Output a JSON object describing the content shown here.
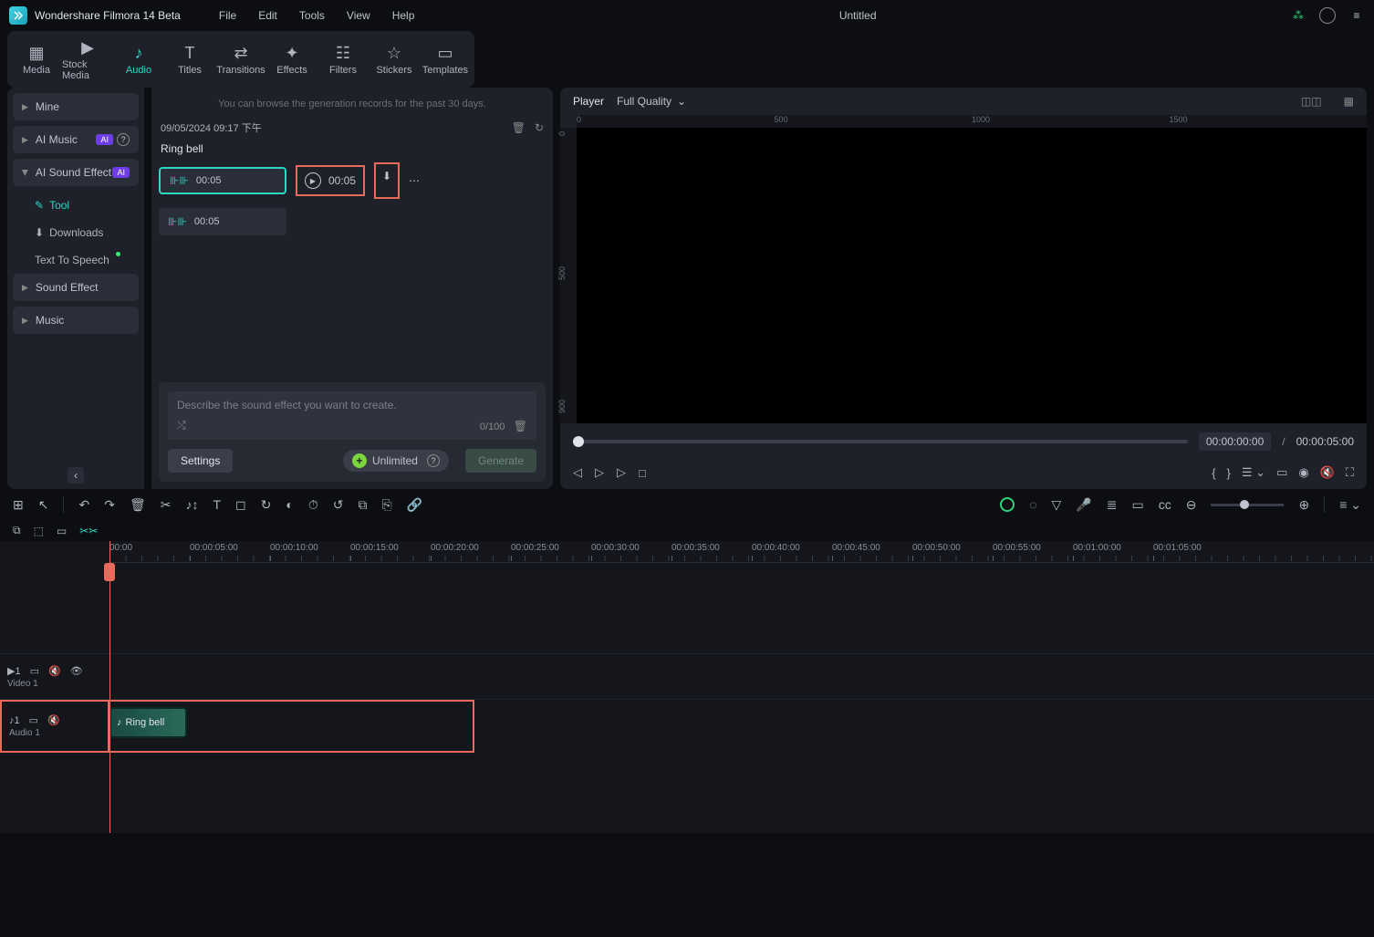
{
  "app": {
    "title": "Wondershare Filmora 14 Beta",
    "doc": "Untitled"
  },
  "menu": [
    "File",
    "Edit",
    "Tools",
    "View",
    "Help"
  ],
  "tabs": [
    {
      "label": "Media",
      "icon": "▦"
    },
    {
      "label": "Stock Media",
      "icon": "▶"
    },
    {
      "label": "Audio",
      "icon": "♪"
    },
    {
      "label": "Titles",
      "icon": "T"
    },
    {
      "label": "Transitions",
      "icon": "⇄"
    },
    {
      "label": "Effects",
      "icon": "✦"
    },
    {
      "label": "Filters",
      "icon": "⋮⋮"
    },
    {
      "label": "Stickers",
      "icon": "☆"
    },
    {
      "label": "Templates",
      "icon": "▭"
    }
  ],
  "sidebar": {
    "mine": "Mine",
    "ai_music": "AI Music",
    "ai_sfx": "AI Sound Effect",
    "tool": "Tool",
    "downloads": "Downloads",
    "tts": "Text To Speech",
    "sound_effect": "Sound Effect",
    "music": "Music"
  },
  "panel": {
    "note": "You can browse the generation records for the past 30 days.",
    "date": "09/05/2024 09:17 下午",
    "title": "Ring bell",
    "dur1": "00:05",
    "play_dur": "00:05",
    "dur2": "00:05",
    "placeholder": "Describe the sound effect you want to create.",
    "count": "0/100",
    "settings": "Settings",
    "unlimited": "Unlimited",
    "generate": "Generate"
  },
  "player": {
    "label": "Player",
    "quality": "Full Quality",
    "ruler_h": [
      "0",
      "500",
      "1000",
      "1500"
    ],
    "ruler_v": [
      "0",
      "500",
      "900"
    ],
    "time_cur": "00:00:00:00",
    "time_tot": "00:00:05:00"
  },
  "timeline": {
    "marks": [
      "00:00",
      "00:00:05:00",
      "00:00:10:00",
      "00:00:15:00",
      "00:00:20:00",
      "00:00:25:00",
      "00:00:30:00",
      "00:00:35:00",
      "00:00:40:00",
      "00:00:45:00",
      "00:00:50:00",
      "00:00:55:00",
      "00:01:00:00",
      "00:01:05:00"
    ],
    "video_track": {
      "num": "1",
      "name": "Video 1"
    },
    "audio_track": {
      "num": "1",
      "name": "Audio 1"
    },
    "clip_name": "Ring bell"
  }
}
